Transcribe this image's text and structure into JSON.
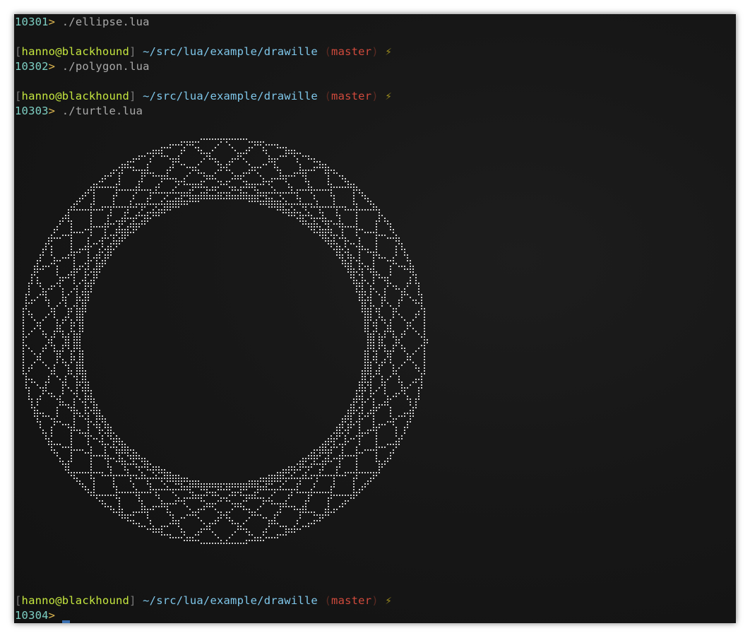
{
  "terminal": {
    "colors": {
      "background": "#151515",
      "history_number": "#7ed0c4",
      "prompt_caret": "#e0b850",
      "command_text": "#a9a9a9",
      "user_host": "#c5e63f",
      "path": "#7fc7ea",
      "branch": "#d04a3c",
      "drawing_dots": "#cfcfcf",
      "cursor": "#3a6fb0"
    },
    "lines": [
      {
        "type": "command",
        "number": "10301",
        "caret": ">",
        "command": " ./ellipse.lua"
      },
      {
        "type": "prompt",
        "open": "[",
        "user_host": "hanno@blackhound",
        "close": "]",
        "path": " ~/src/lua/example/drawille ",
        "paren_open": "(",
        "branch": "master",
        "paren_close": ")",
        "icon": "lightning-bolt-icon",
        "glyph": " ⚡"
      },
      {
        "type": "command",
        "number": "10302",
        "caret": ">",
        "command": " ./polygon.lua"
      },
      {
        "type": "prompt",
        "open": "[",
        "user_host": "hanno@blackhound",
        "close": "]",
        "path": " ~/src/lua/example/drawille ",
        "paren_open": "(",
        "branch": "master",
        "paren_close": ")",
        "icon": "lightning-bolt-icon",
        "glyph": " ⚡"
      },
      {
        "type": "command",
        "number": "10303",
        "caret": ">",
        "command": " ./turtle.lua"
      },
      {
        "type": "prompt",
        "open": "[",
        "user_host": "hanno@blackhound",
        "close": "]",
        "path": " ~/src/lua/example/drawille ",
        "paren_open": "(",
        "branch": "master",
        "paren_close": ")",
        "icon": "lightning-bolt-icon",
        "glyph": " ⚡"
      },
      {
        "type": "command",
        "number": "10304",
        "caret": ">",
        "command": ""
      }
    ]
  }
}
